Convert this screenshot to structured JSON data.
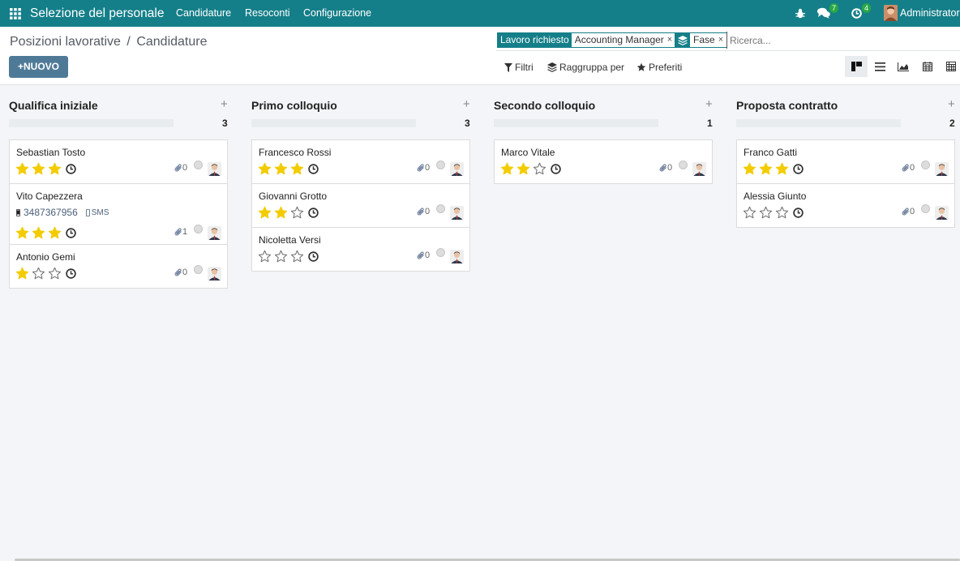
{
  "topbar": {
    "app_title": "Selezione del personale",
    "menu": [
      "Candidature",
      "Resoconti",
      "Configurazione"
    ],
    "chat_count": "7",
    "activity_count": "4",
    "user_name": "Administrator"
  },
  "breadcrumb": {
    "parent": "Posizioni lavorative",
    "separator": "/",
    "current": "Candidature"
  },
  "new_button": "NUOVO",
  "search": {
    "facets": [
      {
        "label": "Lavoro richiesto",
        "value": "Accounting Manager",
        "remove": "×"
      },
      {
        "label": "",
        "value": "Fase",
        "remove": "×"
      }
    ],
    "placeholder": "Ricerca..."
  },
  "filters": {
    "filter_label": "Filtri",
    "group_label": "Raggruppa per",
    "fav_label": "Preferiti"
  },
  "views": [
    "kanban-icon",
    "list-icon",
    "graph-icon",
    "calendar-icon",
    "pivot-icon"
  ],
  "colors": {
    "brand": "#157f89",
    "star": "#f3cc00",
    "primary_button": "#4f7a97"
  },
  "columns": [
    {
      "title": "Qualifica iniziale",
      "count": "3",
      "cards": [
        {
          "name": "Sebastian Tosto",
          "stars": 3,
          "attachments": "0"
        },
        {
          "name": "Vito Capezzera",
          "stars": 3,
          "attachments": "1",
          "phone": "3487367956",
          "sms": "SMS"
        },
        {
          "name": "Antonio Gemi",
          "stars": 1,
          "attachments": "0"
        }
      ]
    },
    {
      "title": "Primo colloquio",
      "count": "3",
      "cards": [
        {
          "name": "Francesco Rossi",
          "stars": 3,
          "attachments": "0"
        },
        {
          "name": "Giovanni Grotto",
          "stars": 2,
          "attachments": "0"
        },
        {
          "name": "Nicoletta Versi",
          "stars": 0,
          "attachments": "0"
        }
      ]
    },
    {
      "title": "Secondo colloquio",
      "count": "1",
      "cards": [
        {
          "name": "Marco Vitale",
          "stars": 2,
          "attachments": "0"
        }
      ]
    },
    {
      "title": "Proposta contratto",
      "count": "2",
      "cards": [
        {
          "name": "Franco Gatti",
          "stars": 3,
          "attachments": "0"
        },
        {
          "name": "Alessia Giunto",
          "stars": 0,
          "attachments": "0"
        }
      ]
    }
  ]
}
